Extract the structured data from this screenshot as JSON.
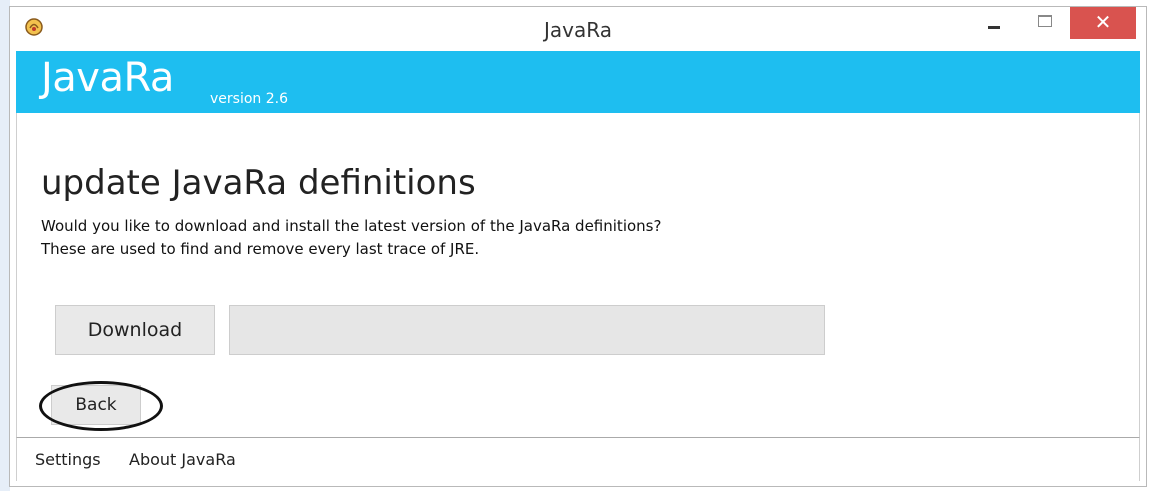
{
  "window": {
    "title": "JavaRa",
    "icon": "javara-app-icon",
    "close_glyph": "✕"
  },
  "banner": {
    "app_name": "JavaRa",
    "version": "version 2.6",
    "color": "#1ebef0"
  },
  "main": {
    "heading": "update JavaRa definitions",
    "description_line1": "Would you like to download and install the latest version of the JavaRa definitions?",
    "description_line2": "These are used to find and remove every last trace of JRE.",
    "download_label": "Download",
    "progress_fraction": 0,
    "back_label": "Back"
  },
  "footer": {
    "settings_label": "Settings",
    "about_label": "About JavaRa"
  }
}
